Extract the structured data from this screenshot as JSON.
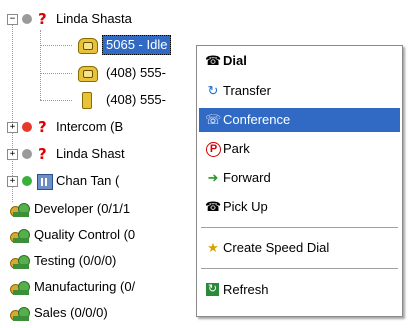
{
  "tree": {
    "linda1": {
      "label": "Linda Shasta"
    },
    "ext": {
      "label": "5065 - Idle"
    },
    "num1": {
      "label": "(408) 555-"
    },
    "num2": {
      "label": "(408) 555-"
    },
    "intercom": {
      "label": "Intercom (B"
    },
    "linda2": {
      "label": "Linda Shast"
    },
    "chan": {
      "label": "Chan Tan ("
    },
    "groups": [
      {
        "label": "Developer  (0/1/1"
      },
      {
        "label": "Quality Control  (0"
      },
      {
        "label": "Testing  (0/0/0)"
      },
      {
        "label": "Manufacturing  (0/"
      },
      {
        "label": "Sales  (0/0/0)"
      }
    ]
  },
  "context_menu": {
    "items": [
      {
        "label": "Dial",
        "icon": "dial-icon",
        "bold": true
      },
      {
        "label": "Transfer",
        "icon": "transfer-icon"
      },
      {
        "label": "Conference",
        "icon": "conference-icon",
        "highlighted": true
      },
      {
        "label": "Park",
        "icon": "park-icon"
      },
      {
        "label": "Forward",
        "icon": "forward-icon"
      },
      {
        "label": "Pick Up",
        "icon": "pickup-icon"
      },
      {
        "label": "Create Speed Dial",
        "icon": "speed-dial-icon"
      },
      {
        "label": "Refresh",
        "icon": "refresh-icon"
      }
    ]
  },
  "colors": {
    "selection": "#316ac5",
    "status_gray": "#9a9a9a",
    "status_red": "#e63a2f",
    "status_green": "#38b03c"
  }
}
